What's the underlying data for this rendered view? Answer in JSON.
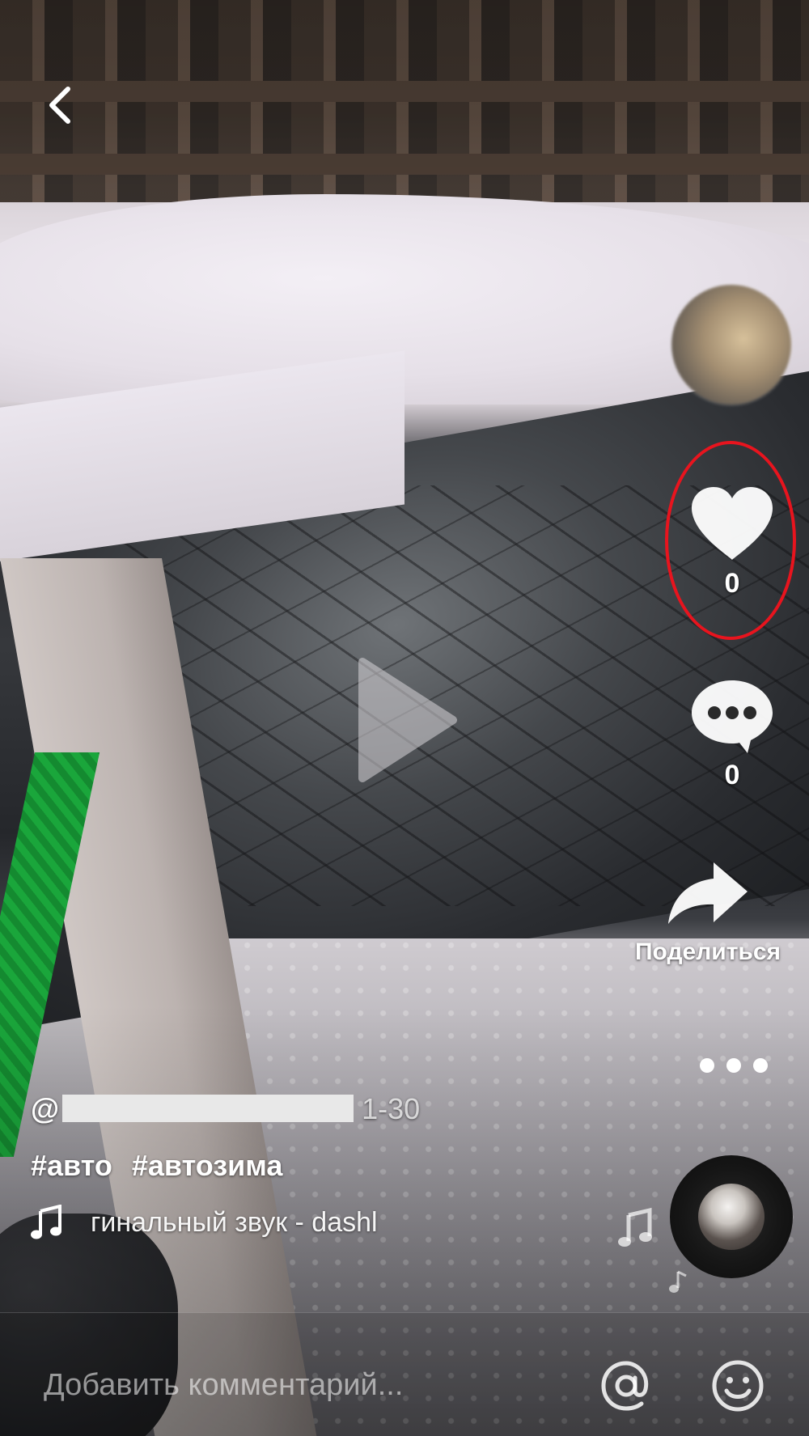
{
  "player": {
    "back_icon": "chevron-left-icon",
    "play_icon": "play-icon"
  },
  "sidebar": {
    "profile_avatar": "avatar",
    "like": {
      "icon": "heart-icon",
      "count": "0",
      "highlight_color": "#e8141e"
    },
    "comment": {
      "icon": "comment-bubble-icon",
      "count": "0"
    },
    "share": {
      "icon": "share-arrow-icon",
      "label": "Поделиться"
    },
    "more_icon": "more-dots-icon",
    "music_disc_icon": "music-disc"
  },
  "caption": {
    "username_prefix": "@",
    "date": "1-30",
    "hashtags": [
      "#авто",
      "#автозима"
    ],
    "sound": "гинальный звук - dashl"
  },
  "comment_bar": {
    "placeholder": "Добавить комментарий...",
    "mention_icon": "at-sign-icon",
    "emoji_icon": "smiley-icon"
  },
  "colors": {
    "text": "#ffffff",
    "highlight": "#e8141e"
  }
}
